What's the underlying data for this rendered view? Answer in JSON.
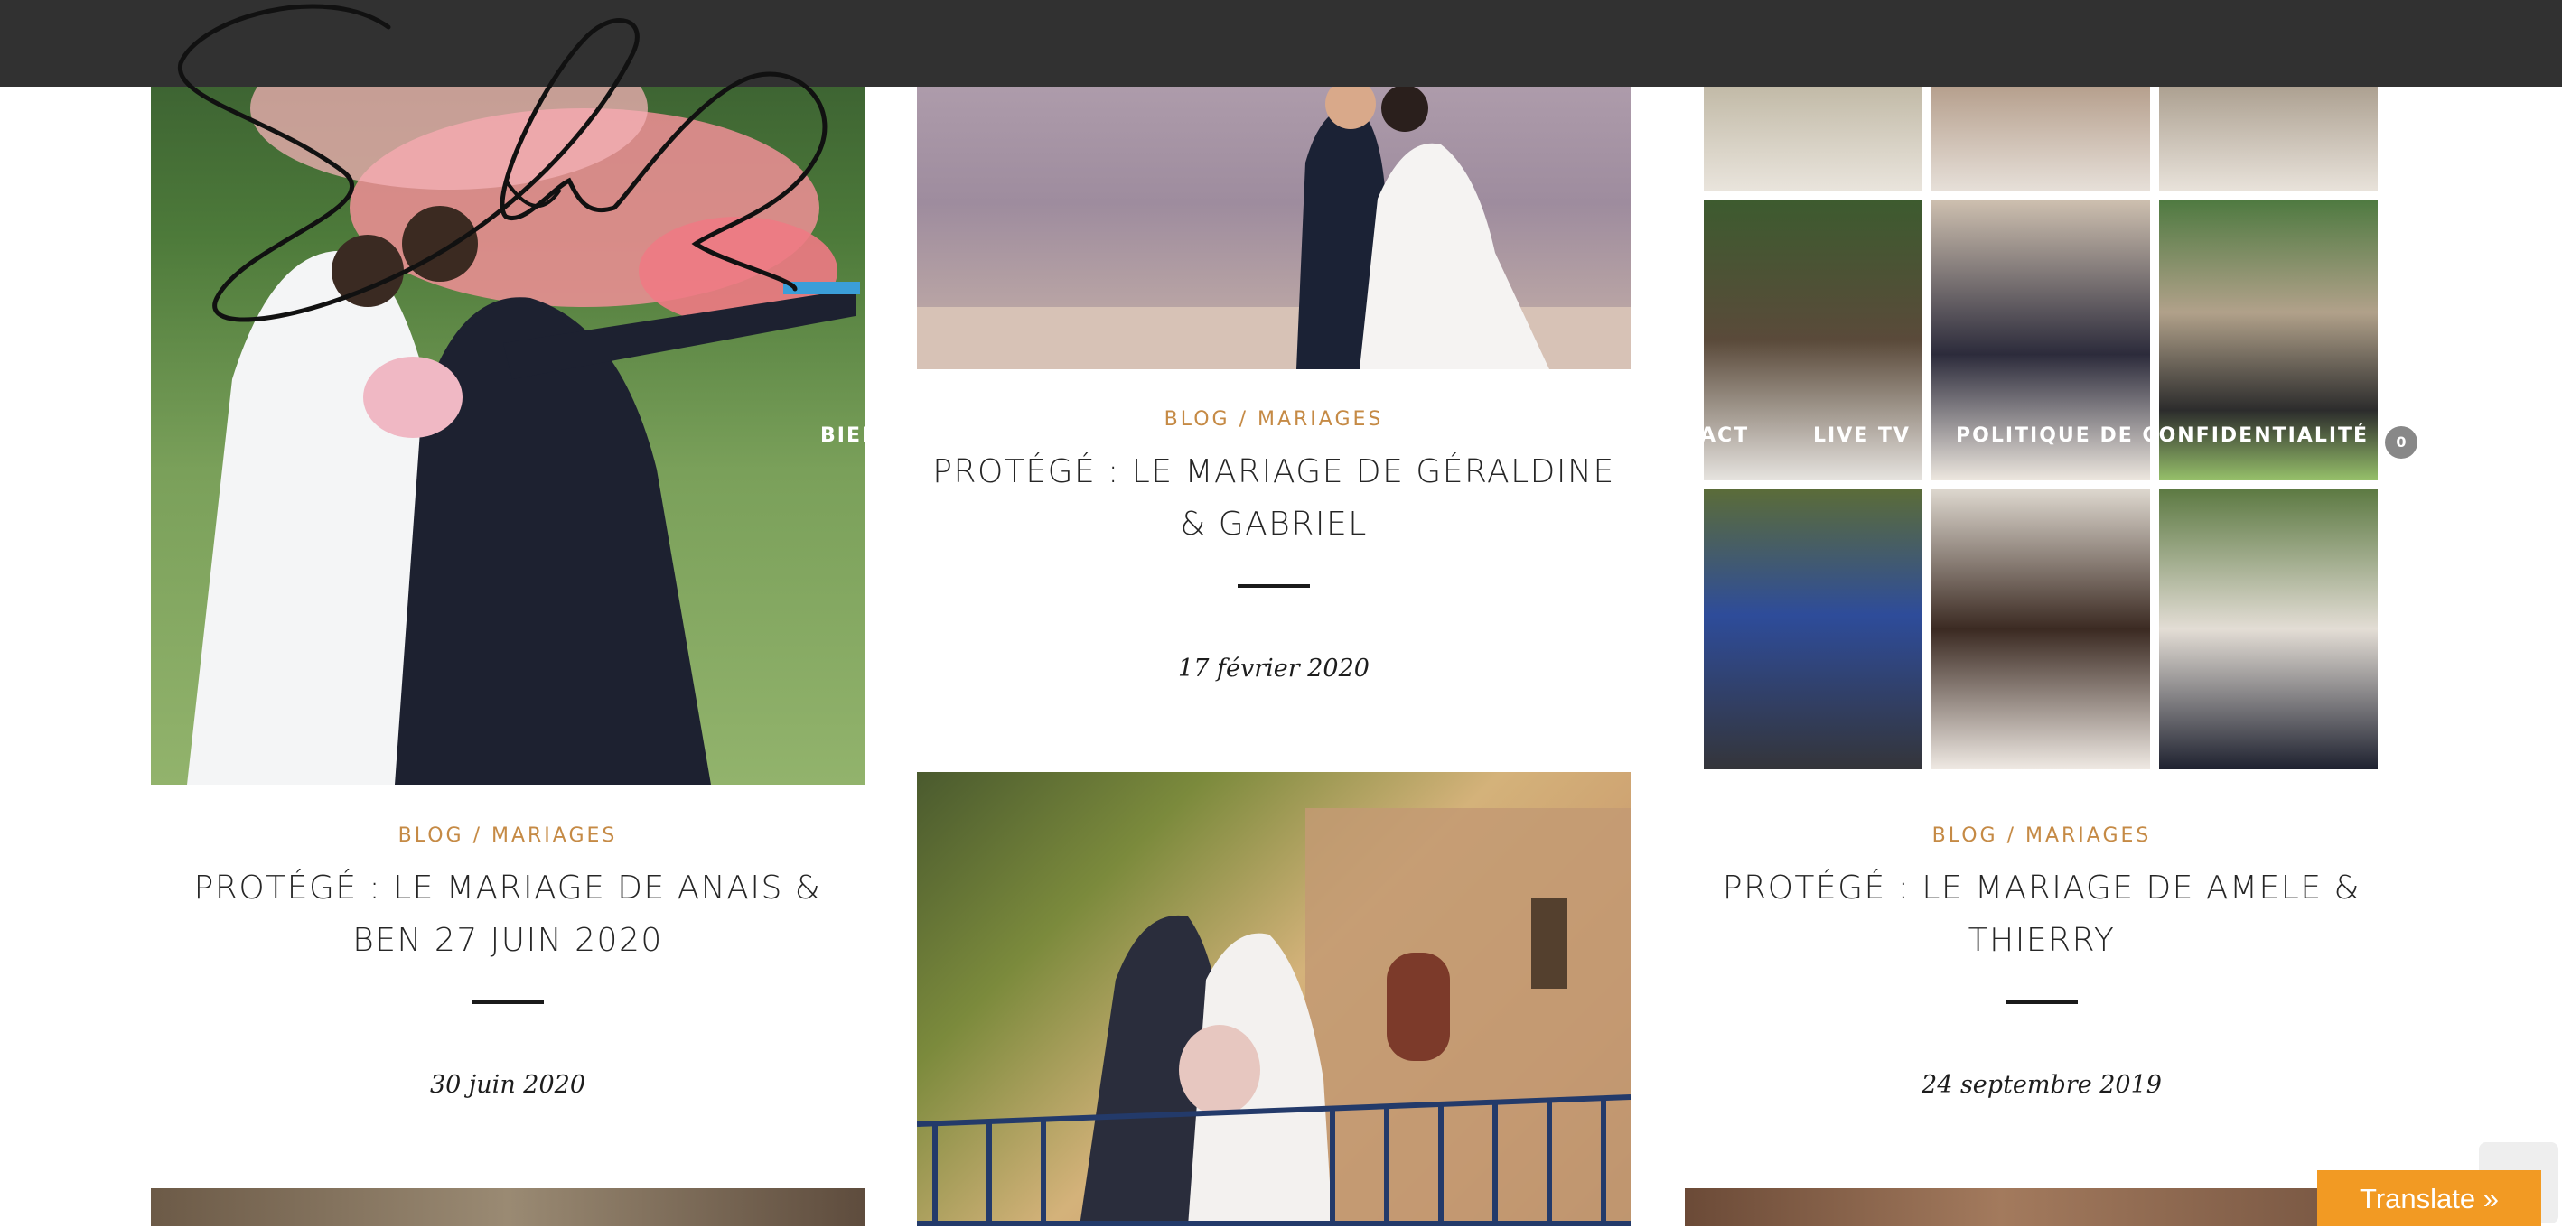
{
  "nav": {
    "items": [
      "BIEN",
      "ACT",
      "LIVE TV",
      "POLITIQUE DE CONFIDENTIALITÉ"
    ],
    "cart_count": "0"
  },
  "posts": [
    {
      "category": "BLOG / MARIAGES",
      "title": "PROTÉGÉ : LE MARIAGE DE ANAIS & BEN 27 JUIN 2020",
      "date": "30 juin 2020"
    },
    {
      "category": "BLOG / MARIAGES",
      "title": "PROTÉGÉ : LE MARIAGE DE GÉRALDINE & GABRIEL",
      "date": "17 février 2020"
    },
    {
      "category": "BLOG / MARIAGES",
      "title": "PROTÉGÉ : LE MARIAGE DE AMELE & THIERRY",
      "date": "24 septembre 2019"
    }
  ],
  "translate_label": "Translate »",
  "colors": {
    "header": "#313131",
    "category": "#c58a45",
    "translate": "#f29a23"
  }
}
